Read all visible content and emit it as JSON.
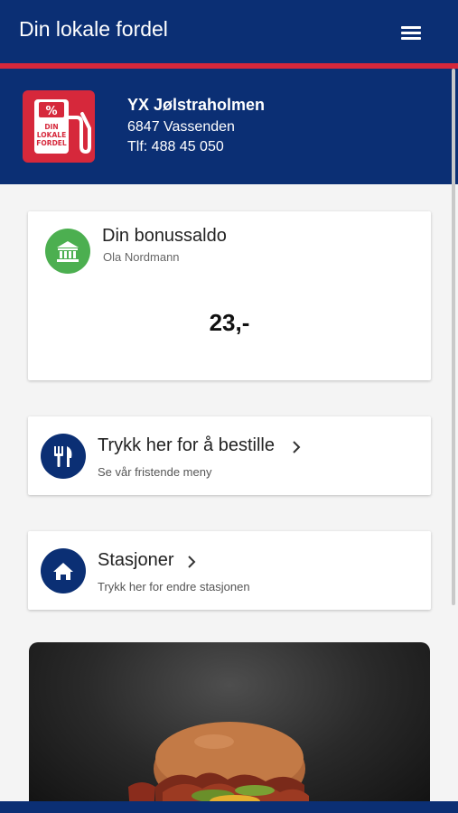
{
  "header": {
    "title": "Din lokale fordel",
    "menu_icon": "hamburger-menu-icon"
  },
  "colors": {
    "brand_blue": "#0b2f74",
    "brand_red": "#d6283b",
    "bonus_green": "#4caf50"
  },
  "station": {
    "logo_lines": [
      "%",
      "DIN",
      "LOKALE",
      "FORDEL"
    ],
    "name": "YX Jølstraholmen",
    "address": "6847 Vassenden",
    "phone": "Tlf: 488 45 050"
  },
  "bonus": {
    "icon": "bank-icon",
    "title": "Din bonussaldo",
    "owner": "Ola Nordmann",
    "amount": "23,-"
  },
  "order": {
    "icon": "cutlery-icon",
    "title": "Trykk her for å bestille",
    "subtitle": "Se vår fristende meny"
  },
  "stations_link": {
    "icon": "home-icon",
    "title": "Stasjoner",
    "subtitle": "Trykk her for endre stasjonen"
  },
  "promo": {
    "image": "burger-photo"
  }
}
